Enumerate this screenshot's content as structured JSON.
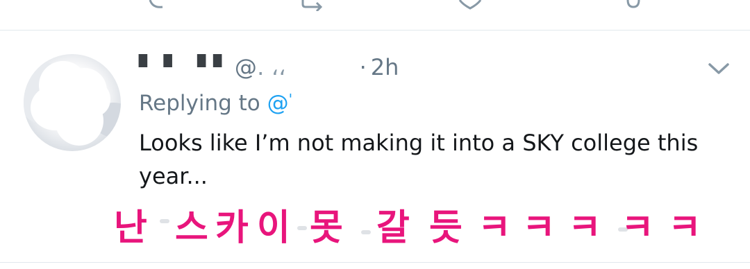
{
  "action_bar": {
    "icons": [
      "reply-icon",
      "retweet-icon",
      "like-icon",
      "share-icon"
    ]
  },
  "tweet": {
    "display_name_obscured": "▘  ▘ ▝ ▘",
    "handle_prefix": "@",
    "handle_obscured": "․ ،، ",
    "separator": "·",
    "time": "2h",
    "replying_to_label": "Replying to",
    "replying_to_handle": "@",
    "text": "Looks like I’m not making it into a SKY college this year...",
    "menu_icon": "chevron-down-icon"
  },
  "subtitle": {
    "chars": [
      "난",
      "스",
      "카",
      "이",
      "못",
      "갈",
      "듯",
      "ㅋ",
      "ㅋ",
      "ㅋ",
      "ㅋ",
      "ㅋ"
    ]
  },
  "colors": {
    "secondary_text": "#657786",
    "primary_text": "#14171a",
    "link": "#1da1f2",
    "subtitle": "#e8157c",
    "divider": "#e1e8ed"
  }
}
